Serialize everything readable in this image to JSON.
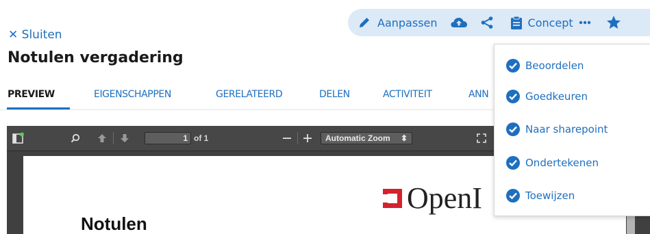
{
  "toolbar": {
    "edit_label": "Aanpassen",
    "status_label": "Concept",
    "icons": [
      "pencil-icon",
      "cloud-upload-icon",
      "share-icon",
      "clipboard-icon",
      "more-icon",
      "star-icon"
    ]
  },
  "close_label": "Sluiten",
  "page_title": "Notulen vergadering",
  "tabs": [
    {
      "label": "PREVIEW",
      "active": true
    },
    {
      "label": "EIGENSCHAPPEN",
      "active": false
    },
    {
      "label": "GERELATEERD",
      "active": false
    },
    {
      "label": "DELEN",
      "active": false
    },
    {
      "label": "ACTIVITEIT",
      "active": false
    },
    {
      "label": "ANN",
      "active": false
    }
  ],
  "pdf_viewer": {
    "page_number": "1",
    "page_count_label": "of 1",
    "zoom_label": "Automatic Zoom",
    "document": {
      "heading": "Notulen",
      "logo_text": "OpenI"
    }
  },
  "dropdown": {
    "items": [
      {
        "label": "Beoordelen"
      },
      {
        "label": "Goedkeuren"
      },
      {
        "label": "Naar sharepoint"
      },
      {
        "label": "Ondertekenen"
      },
      {
        "label": "Toewijzen"
      }
    ]
  },
  "colors": {
    "accent": "#1e6fbf",
    "toolbar_bg": "#dce9f7",
    "logo_red": "#d3222e",
    "viewer_bg": "#404040"
  }
}
